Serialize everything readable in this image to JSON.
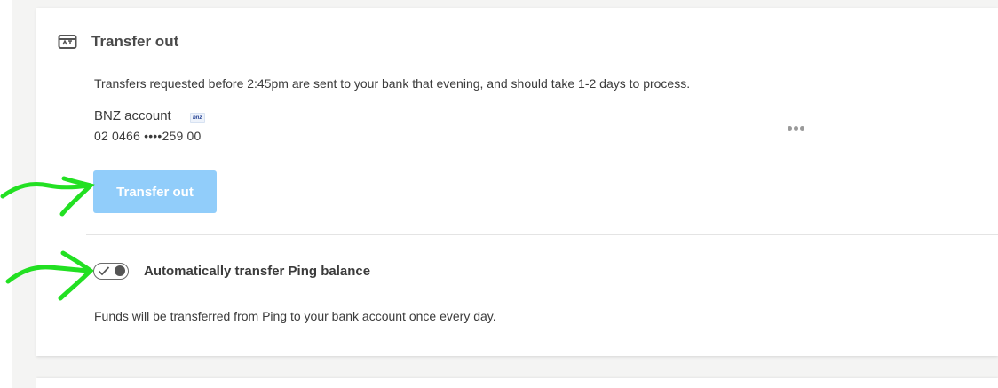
{
  "transfer_section": {
    "title": "Transfer out",
    "description": "Transfers requested before 2:45pm are sent to your bank that evening, and should take 1-2 days to process.",
    "bank_account": {
      "name": "BNZ account",
      "logo_text": "bnz",
      "number": "02 0466 ••••259 00"
    },
    "more_icon": "more-horizontal-icon",
    "transfer_button_label": "Transfer out",
    "transfer_button_color": "#91cdfa"
  },
  "auto_transfer": {
    "label": "Automatically transfer Ping balance",
    "toggle_state": "on",
    "note": "Funds will be transferred from Ping to your bank account once every day."
  },
  "annotations": {
    "arrow_color": "#22e022"
  }
}
